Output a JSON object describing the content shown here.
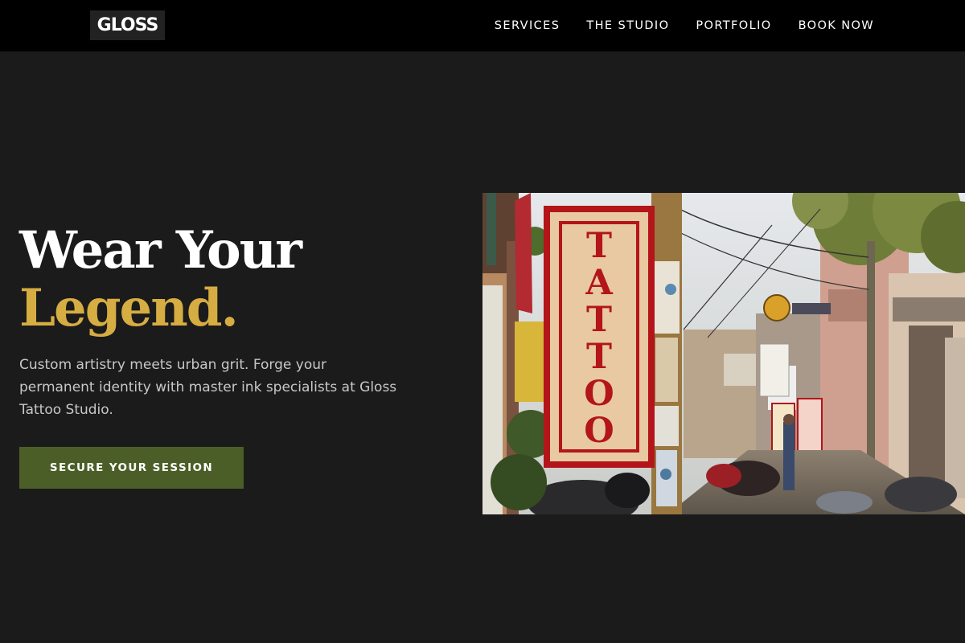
{
  "brand": {
    "logo": "GLOSS"
  },
  "nav": {
    "items": [
      {
        "label": "SERVICES"
      },
      {
        "label": "THE STUDIO"
      },
      {
        "label": "PORTFOLIO"
      },
      {
        "label": "BOOK NOW"
      }
    ]
  },
  "hero": {
    "title_line1": "Wear Your",
    "title_line2": "Legend.",
    "description": "Custom artistry meets urban grit. Forge your permanent identity with master ink specialists at Gloss Tattoo Studio.",
    "cta_label": "SECURE YOUR SESSION",
    "image": {
      "sign_letters": [
        "T",
        "A",
        "T",
        "T",
        "O",
        "O"
      ]
    }
  },
  "colors": {
    "background": "#1b1b1b",
    "navbar": "#000000",
    "accent_gold": "#d6ad42",
    "cta_green": "#4b5e27"
  }
}
